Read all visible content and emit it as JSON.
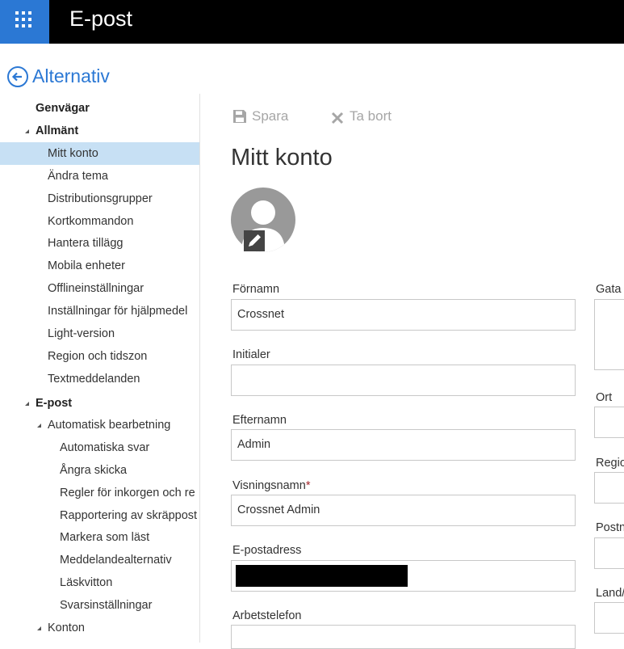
{
  "app": {
    "title": "E-post"
  },
  "back": {
    "label": "Alternativ"
  },
  "nav": {
    "items": [
      {
        "label": "Genvägar"
      },
      {
        "label": "Allmänt"
      },
      {
        "label": "Mitt konto"
      },
      {
        "label": "Ändra tema"
      },
      {
        "label": "Distributionsgrupper"
      },
      {
        "label": "Kortkommandon"
      },
      {
        "label": "Hantera tillägg"
      },
      {
        "label": "Mobila enheter"
      },
      {
        "label": "Offlineinställningar"
      },
      {
        "label": "Inställningar för hjälpmedel"
      },
      {
        "label": "Light-version"
      },
      {
        "label": "Region och tidszon"
      },
      {
        "label": "Textmeddelanden"
      },
      {
        "label": "E-post"
      },
      {
        "label": "Automatisk bearbetning"
      },
      {
        "label": "Automatiska svar"
      },
      {
        "label": "Ångra skicka"
      },
      {
        "label": "Regler för inkorgen och re"
      },
      {
        "label": "Rapportering av skräppost"
      },
      {
        "label": "Markera som läst"
      },
      {
        "label": "Meddelandealternativ"
      },
      {
        "label": "Läskvitton"
      },
      {
        "label": "Svarsinställningar"
      },
      {
        "label": "Konton"
      }
    ]
  },
  "toolbar": {
    "save_label": "Spara",
    "delete_label": "Ta bort"
  },
  "page": {
    "title": "Mitt konto"
  },
  "form": {
    "first_name": {
      "label": "Förnamn",
      "value": "Crossnet"
    },
    "initials": {
      "label": "Initialer",
      "value": ""
    },
    "last_name": {
      "label": "Efternamn",
      "value": "Admin"
    },
    "display_name": {
      "label": "Visningsnamn",
      "required_mark": "*",
      "value": "Crossnet Admin"
    },
    "email": {
      "label": "E-postadress",
      "value": ""
    },
    "work_phone": {
      "label": "Arbetstelefon",
      "value": ""
    },
    "street": {
      "label": "Gata"
    },
    "city": {
      "label": "Ort"
    },
    "region": {
      "label": "Regio"
    },
    "postal": {
      "label": "Postn"
    },
    "country": {
      "label": "Land/"
    }
  },
  "colors": {
    "accent": "#2b78d4",
    "selected": "#c7e0f4",
    "topbar": "#000000"
  }
}
